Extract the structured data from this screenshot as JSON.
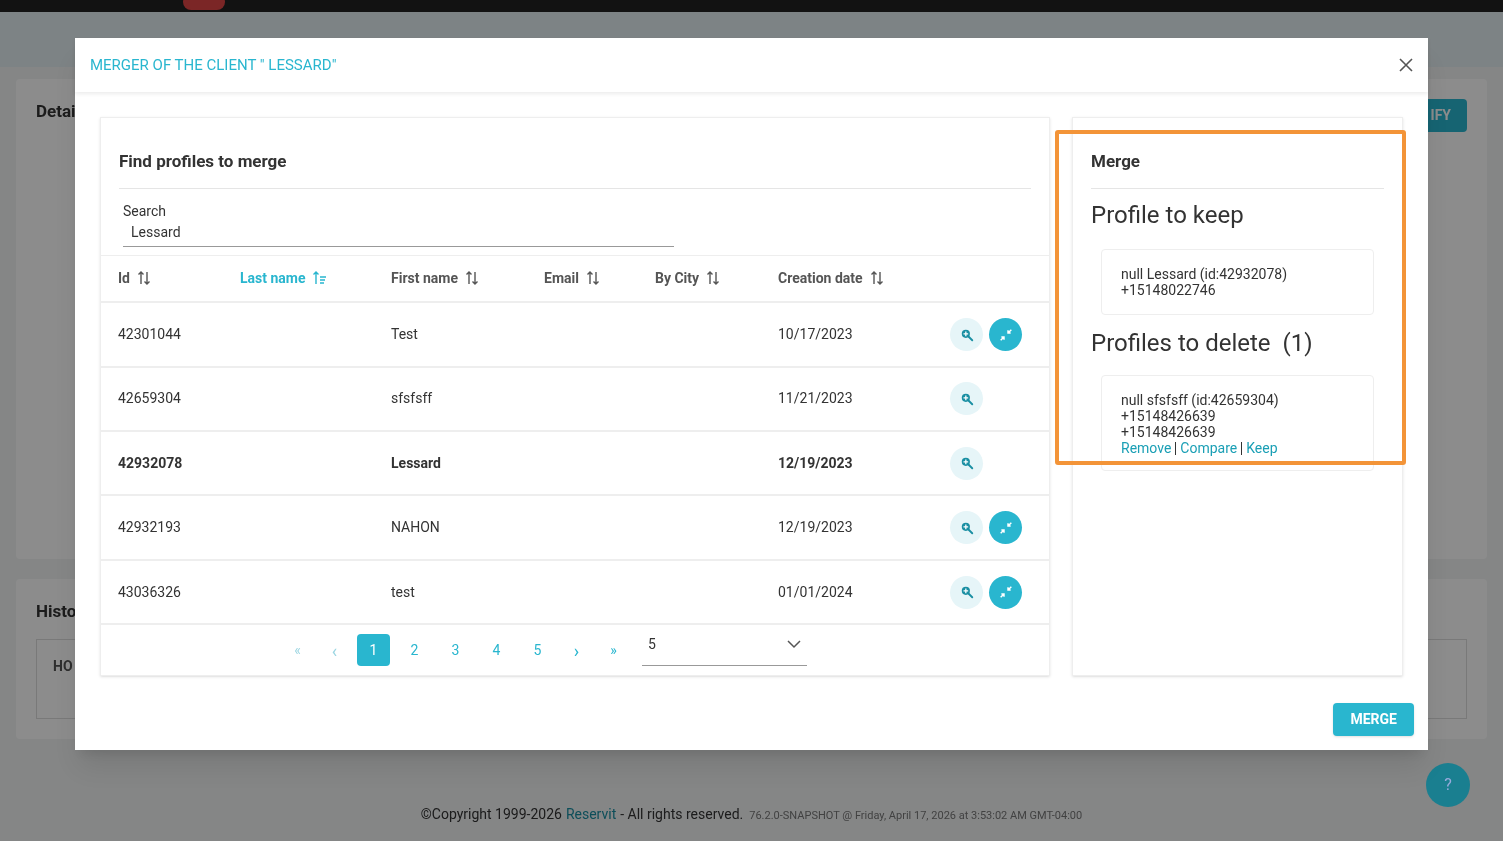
{
  "background": {
    "details_title": "Detai",
    "modify_button": "IFY",
    "history_title": "Histo",
    "history_column": "HO"
  },
  "modal": {
    "title": "MERGER OF THE CLIENT \" LESSARD\"",
    "search_panel": {
      "title": "Find profiles to merge",
      "search": {
        "label": "Search",
        "value": "Lessard"
      },
      "columns": [
        {
          "label": "Id",
          "sorted": false
        },
        {
          "label": "Last name",
          "sorted": true
        },
        {
          "label": "First name",
          "sorted": false
        },
        {
          "label": "Email",
          "sorted": false
        },
        {
          "label": "By City",
          "sorted": false
        },
        {
          "label": "Creation date",
          "sorted": false
        }
      ],
      "rows": [
        {
          "id": "42301044",
          "first_name": "Test",
          "creation_date": "10/17/2023",
          "current": false,
          "mergeable": true
        },
        {
          "id": "42659304",
          "first_name": "sfsfsff",
          "creation_date": "11/21/2023",
          "current": false,
          "mergeable": false
        },
        {
          "id": "42932078",
          "first_name": "Lessard",
          "creation_date": "12/19/2023",
          "current": true,
          "mergeable": false
        },
        {
          "id": "42932193",
          "first_name": "NAHON",
          "creation_date": "12/19/2023",
          "current": false,
          "mergeable": true
        },
        {
          "id": "43036326",
          "first_name": "test",
          "creation_date": "01/01/2024",
          "current": false,
          "mergeable": true
        }
      ],
      "pagination": {
        "first": "«",
        "prev": "‹",
        "pages": [
          {
            "label": "1",
            "selected": true
          },
          {
            "label": "2",
            "selected": false
          },
          {
            "label": "3",
            "selected": false
          },
          {
            "label": "4",
            "selected": false
          },
          {
            "label": "5",
            "selected": false
          }
        ],
        "next": "›",
        "last": "»",
        "page_size": "5"
      }
    },
    "merge_panel": {
      "title": "Merge",
      "highlighted": true,
      "keep_heading": "Profile to keep",
      "keep_lines": [
        "null Lessard (id:42932078)",
        "+15148022746"
      ],
      "delete_heading": "Profiles to delete  (1)",
      "delete_lines": [
        "null sfsfsff (id:42659304)",
        "+15148426639",
        "+15148426639"
      ],
      "links": [
        "Remove",
        "Compare",
        "Keep"
      ]
    },
    "merge_button": "MERGE"
  },
  "footer": {
    "copyright": "©Copyright 1999-2026",
    "brand": "Reservit",
    "rights": "- All rights reserved.",
    "version": "76.2.0-SNAPSHOT @ Friday, April 17, 2026 at 3:53:02 AM GMT-04:00"
  },
  "help_button": "?"
}
